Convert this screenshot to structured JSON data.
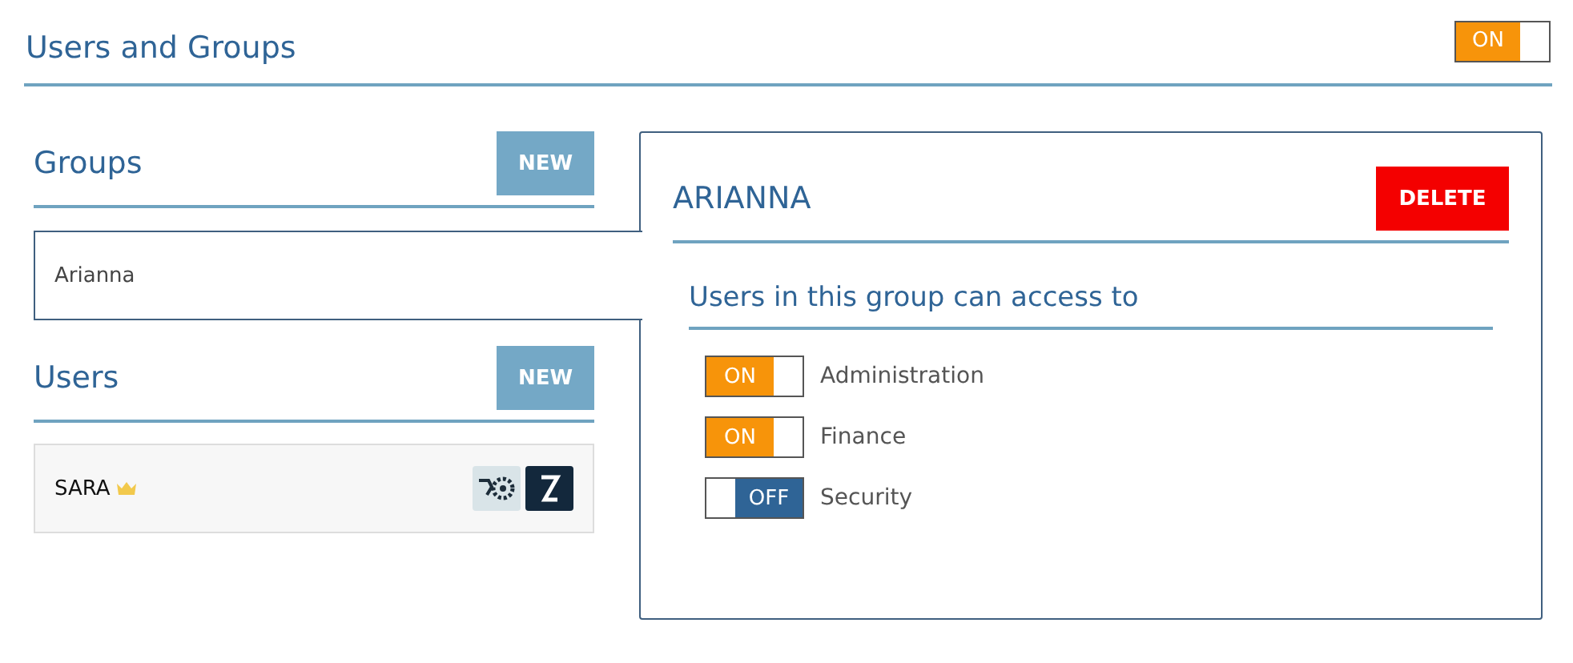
{
  "header": {
    "title": "Users and Groups",
    "toggle": {
      "label": "ON",
      "on": true
    }
  },
  "groups": {
    "title": "Groups",
    "new_button": "NEW",
    "items": [
      {
        "name": "Arianna",
        "selected": true
      }
    ]
  },
  "users": {
    "title": "Users",
    "new_button": "NEW",
    "items": [
      {
        "name": "SARA",
        "admin": true
      }
    ]
  },
  "detail": {
    "title": "ARIANNA",
    "delete_button": "DELETE",
    "subtitle": "Users in this group can access to",
    "permissions": [
      {
        "label": "Administration",
        "toggle": "ON",
        "on": true
      },
      {
        "label": "Finance",
        "toggle": "ON",
        "on": true
      },
      {
        "label": "Security",
        "toggle": "OFF",
        "on": false
      }
    ]
  }
}
